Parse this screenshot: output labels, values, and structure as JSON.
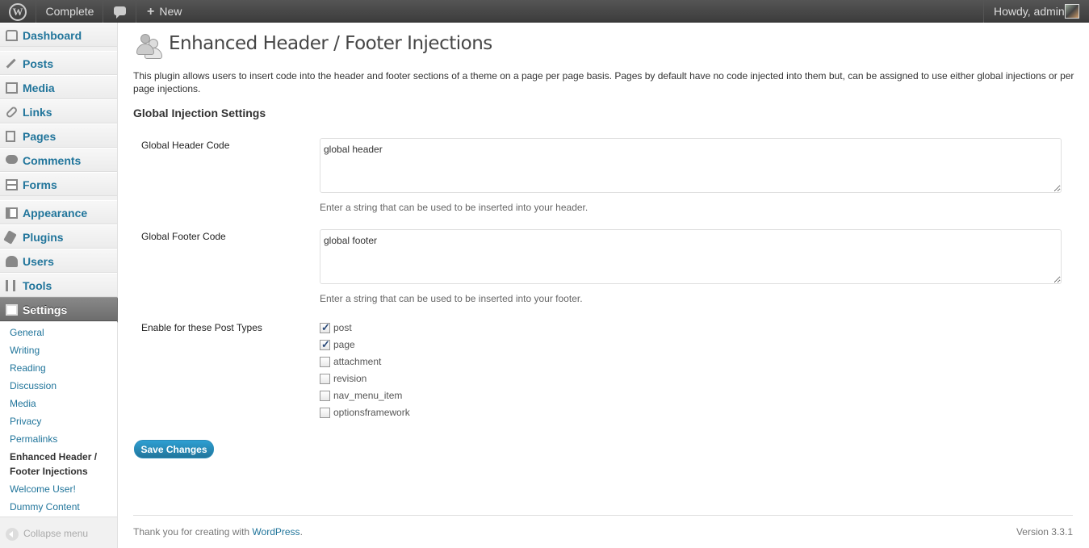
{
  "adminbar": {
    "site_name": "Complete",
    "new_label": "New",
    "account_label": "Howdy, admin"
  },
  "sidebar": {
    "items": [
      {
        "label": "Dashboard"
      },
      {
        "label": "Posts"
      },
      {
        "label": "Media"
      },
      {
        "label": "Links"
      },
      {
        "label": "Pages"
      },
      {
        "label": "Comments"
      },
      {
        "label": "Forms"
      },
      {
        "label": "Appearance"
      },
      {
        "label": "Plugins"
      },
      {
        "label": "Users"
      },
      {
        "label": "Tools"
      },
      {
        "label": "Settings"
      }
    ],
    "submenu": [
      {
        "label": "General"
      },
      {
        "label": "Writing"
      },
      {
        "label": "Reading"
      },
      {
        "label": "Discussion"
      },
      {
        "label": "Media"
      },
      {
        "label": "Privacy"
      },
      {
        "label": "Permalinks"
      },
      {
        "label": "Enhanced Header /"
      },
      {
        "label": "Footer Injections"
      },
      {
        "label": "Welcome User!"
      },
      {
        "label": "Dummy Content"
      }
    ],
    "collapse_label": "Collapse menu"
  },
  "main": {
    "title": "Enhanced Header / Footer Injections",
    "intro": "This plugin allows users to insert code into the header and footer sections of a theme on a page per page basis.  Pages by default have no code injected into them but, can be assigned to use either global injections or per page injections.",
    "section_title": "Global Injection Settings",
    "header_field": {
      "label": "Global Header Code",
      "value": "global header",
      "description": "Enter a string that can be used to be inserted into your header."
    },
    "footer_field": {
      "label": "Global Footer Code",
      "value": "global footer",
      "description": "Enter a string that can be used to be inserted into your footer."
    },
    "post_types": {
      "label": "Enable for these Post Types",
      "options": [
        {
          "label": "post",
          "checked": true
        },
        {
          "label": "page",
          "checked": true
        },
        {
          "label": "attachment",
          "checked": false
        },
        {
          "label": "revision",
          "checked": false
        },
        {
          "label": "nav_menu_item",
          "checked": false
        },
        {
          "label": "optionsframework",
          "checked": false
        }
      ]
    },
    "save_label": "Save Changes"
  },
  "footer": {
    "thanks_prefix": "Thank you for creating with",
    "thanks_link": "WordPress",
    "thanks_suffix": ".",
    "version": "Version 3.3.1"
  },
  "colors": {
    "link": "#21759b",
    "adminbar": "#464646",
    "primary_button": "#21759b"
  }
}
